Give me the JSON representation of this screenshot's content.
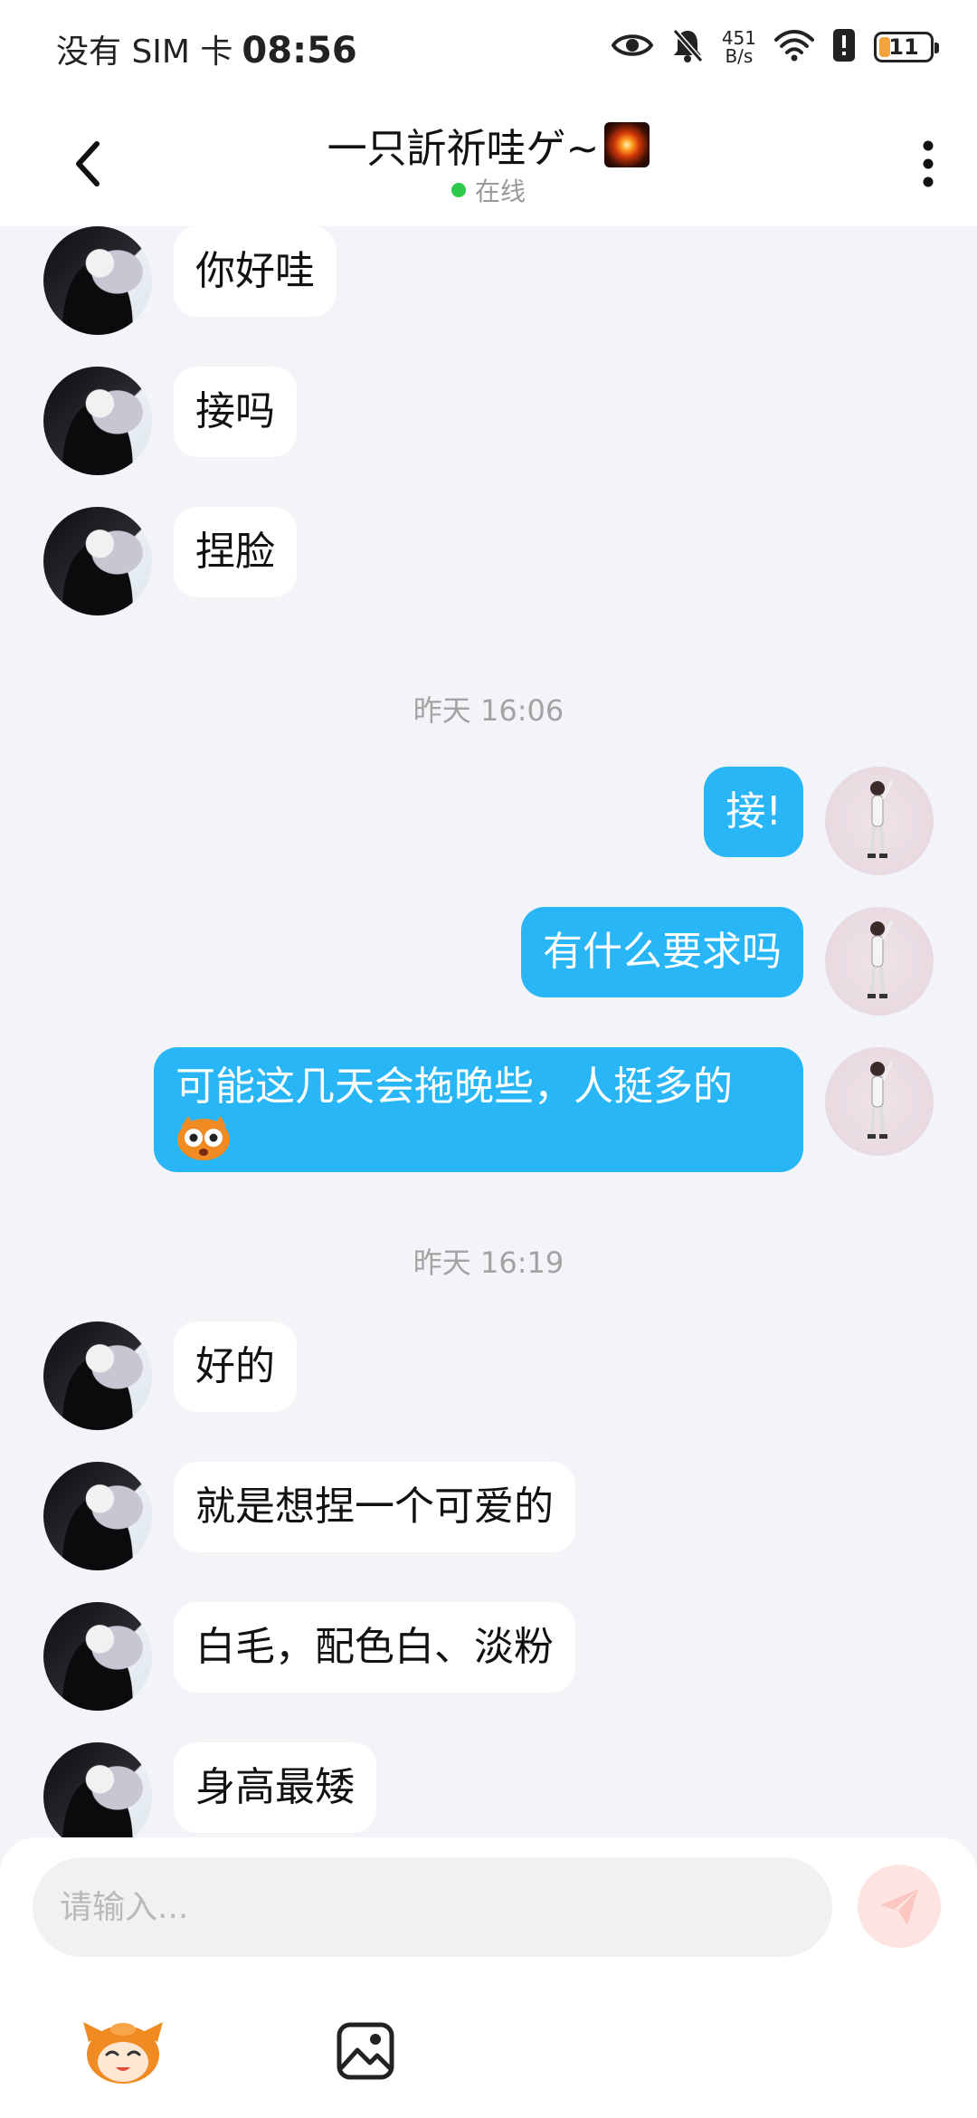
{
  "status_bar": {
    "carrier": "没有 SIM 卡",
    "time": "08:56",
    "net_speed_value": "451",
    "net_speed_unit": "B/s",
    "battery": "11",
    "icons": [
      "eye-icon",
      "bell-off-icon",
      "wifi-icon",
      "alert-icon",
      "battery-icon"
    ]
  },
  "header": {
    "title": "一只訢祈哇ゲ~",
    "status": "在线",
    "status_color": "#2ec84b"
  },
  "messages": [
    {
      "side": "in",
      "text": "你好哇"
    },
    {
      "side": "in",
      "text": "接吗"
    },
    {
      "side": "in",
      "text": "捏脸"
    },
    {
      "type": "time",
      "text": "昨天 16:06"
    },
    {
      "side": "out",
      "text": "接!"
    },
    {
      "side": "out",
      "text": "有什么要求吗"
    },
    {
      "side": "out",
      "text": "可能这几天会拖晚些，人挺多的"
    },
    {
      "type": "time",
      "text": "昨天 16:19"
    },
    {
      "side": "in",
      "text": "好的"
    },
    {
      "side": "in",
      "text": "就是想捏一个可爱的"
    },
    {
      "side": "in",
      "text": "白毛，配色白、淡粉"
    },
    {
      "side": "in",
      "text": "身高最矮"
    }
  ],
  "input": {
    "placeholder": "请输入..."
  },
  "colors": {
    "outgoing_bubble": "#29b6f6",
    "incoming_bubble": "#ffffff",
    "background": "#f2f4f8"
  }
}
